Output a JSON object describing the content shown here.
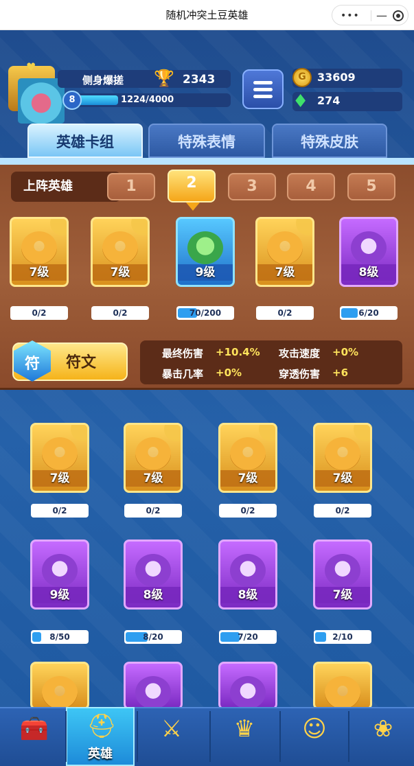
{
  "window": {
    "title": "随机冲突土豆英雄"
  },
  "player": {
    "name": "侧身爆搓",
    "level": "8",
    "trophies": "2343",
    "xp_text": "1224/4000",
    "xp_progress": 0.306
  },
  "currency": {
    "gold": "33609",
    "gems": "274"
  },
  "tabs": [
    {
      "label": "英雄卡组"
    },
    {
      "label": "特殊表情"
    },
    {
      "label": "特殊皮肤"
    }
  ],
  "lineup": {
    "label": "上阵英雄",
    "slots": [
      "1",
      "2",
      "3",
      "4",
      "5"
    ],
    "active_slot": "2"
  },
  "deck_cards": [
    {
      "level": "7级",
      "progress": "0/2",
      "fill": 0,
      "rarity": "gold",
      "icon": "yeti-hero-icon"
    },
    {
      "level": "7级",
      "progress": "0/2",
      "fill": 0,
      "rarity": "gold",
      "icon": "knight-hero-icon"
    },
    {
      "level": "9级",
      "progress": "70/200",
      "fill": 0.35,
      "rarity": "blue",
      "icon": "monocle-hero-icon"
    },
    {
      "level": "7级",
      "progress": "0/2",
      "fill": 0,
      "rarity": "gold",
      "icon": "chef-hero-icon"
    },
    {
      "level": "8级",
      "progress": "6/20",
      "fill": 0.3,
      "rarity": "purple",
      "icon": "hat-hero-icon"
    }
  ],
  "rune": {
    "label": "符文",
    "icon_glyph": "符"
  },
  "stats": [
    {
      "name": "最终伤害",
      "value": "+10.4%"
    },
    {
      "name": "攻击速度",
      "value": "+0%"
    },
    {
      "name": "暴击几率",
      "value": "+0%"
    },
    {
      "name": "穿透伤害",
      "value": "+6"
    }
  ],
  "collection_row1": [
    {
      "level": "7级",
      "progress": "0/2",
      "fill": 0,
      "rarity": "gold",
      "icon": "zeus-hero-icon"
    },
    {
      "level": "7级",
      "progress": "0/2",
      "fill": 0,
      "rarity": "gold",
      "icon": "masked-hero-icon"
    },
    {
      "level": "7级",
      "progress": "0/2",
      "fill": 0,
      "rarity": "gold",
      "icon": "robot-hero-icon"
    },
    {
      "level": "7级",
      "progress": "0/2",
      "fill": 0,
      "rarity": "gold",
      "icon": "cowboy-hero-icon"
    }
  ],
  "collection_row2": [
    {
      "level": "9级",
      "progress": "8/50",
      "fill": 0.16,
      "rarity": "purple",
      "icon": "tophat-hero-icon"
    },
    {
      "level": "8级",
      "progress": "8/20",
      "fill": 0.4,
      "rarity": "purple",
      "icon": "mage-hero-icon"
    },
    {
      "level": "8级",
      "progress": "7/20",
      "fill": 0.35,
      "rarity": "purple",
      "icon": "explorer-hero-icon"
    },
    {
      "level": "7级",
      "progress": "2/10",
      "fill": 0.2,
      "rarity": "purple",
      "icon": "vampire-hero-icon"
    }
  ],
  "nav": [
    {
      "icon": "treasure-chest-icon",
      "label": ""
    },
    {
      "icon": "helmet-icon",
      "label": "英雄"
    },
    {
      "icon": "crossed-swords-icon",
      "label": ""
    },
    {
      "icon": "crown-shield-icon",
      "label": ""
    },
    {
      "icon": "social-icon",
      "label": ""
    },
    {
      "icon": "grass-island-icon",
      "label": ""
    }
  ]
}
